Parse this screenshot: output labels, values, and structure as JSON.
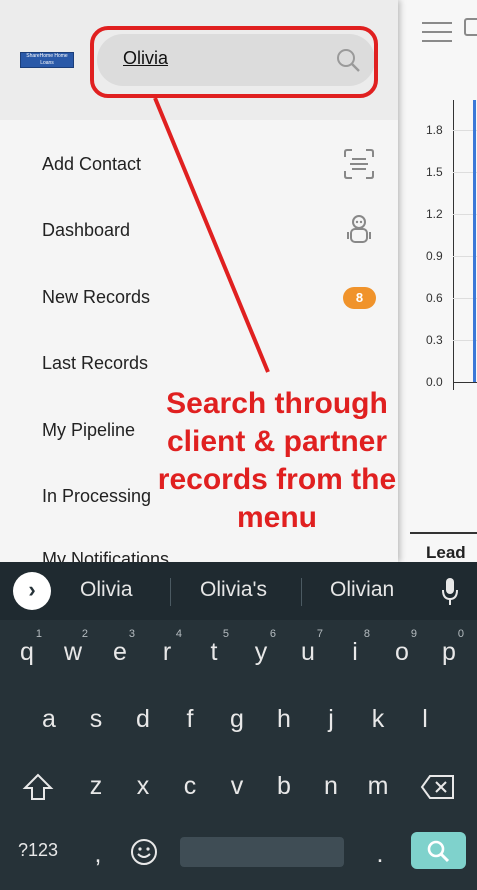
{
  "app": {
    "logo_text": "ShareHome Home Loans",
    "search": {
      "value": "Olivia"
    }
  },
  "menu": {
    "items": [
      {
        "label": "Add Contact"
      },
      {
        "label": "Dashboard"
      },
      {
        "label": "New Records",
        "badge": "8"
      },
      {
        "label": "Last Records"
      },
      {
        "label": "My Pipeline"
      },
      {
        "label": "In Processing"
      },
      {
        "label": "My Notifications"
      }
    ]
  },
  "annotation": {
    "callout": "Search through client & partner records from the menu",
    "color": "#e02020"
  },
  "background": {
    "chart_ticks": [
      "1.8",
      "1.5",
      "1.2",
      "0.9",
      "0.6",
      "0.3",
      "0.0"
    ],
    "lead_label": "Lead"
  },
  "keyboard": {
    "suggestions": [
      "Olivia",
      "Olivia's",
      "Olivian"
    ],
    "row1": [
      {
        "key": "q",
        "num": "1"
      },
      {
        "key": "w",
        "num": "2"
      },
      {
        "key": "e",
        "num": "3"
      },
      {
        "key": "r",
        "num": "4"
      },
      {
        "key": "t",
        "num": "5"
      },
      {
        "key": "y",
        "num": "6"
      },
      {
        "key": "u",
        "num": "7"
      },
      {
        "key": "i",
        "num": "8"
      },
      {
        "key": "o",
        "num": "9"
      },
      {
        "key": "p",
        "num": "0"
      }
    ],
    "row2": [
      "a",
      "s",
      "d",
      "f",
      "g",
      "h",
      "j",
      "k",
      "l"
    ],
    "row3": [
      "z",
      "x",
      "c",
      "v",
      "b",
      "n",
      "m"
    ],
    "symbols_key": "?123",
    "comma_key": ",",
    "period_key": "."
  },
  "colors": {
    "badge": "#f0932b",
    "keyboard_bg": "#263238",
    "search_key": "#7fd2cc"
  }
}
